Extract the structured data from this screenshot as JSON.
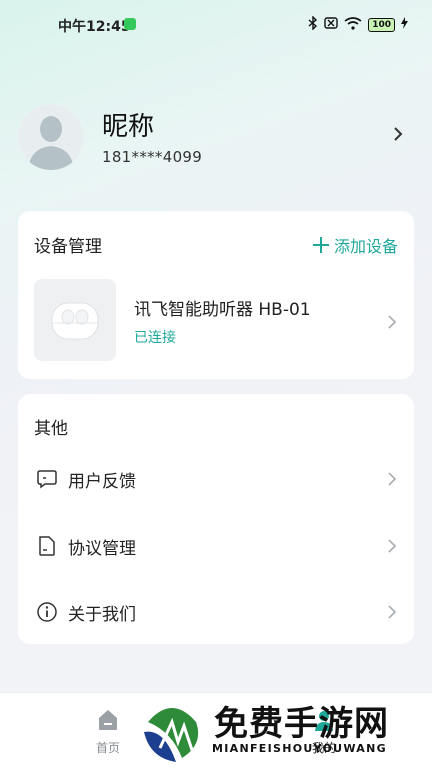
{
  "status_bar": {
    "time": "中午12:45",
    "battery": "100"
  },
  "profile": {
    "nickname": "昵称",
    "phone": "181****4099"
  },
  "device_section": {
    "title": "设备管理",
    "add_label": "添加设备",
    "device": {
      "name": "讯飞智能助听器 HB-01",
      "status": "已连接"
    }
  },
  "other_section": {
    "title": "其他",
    "items": [
      {
        "label": "用户反馈",
        "icon": "message-icon"
      },
      {
        "label": "协议管理",
        "icon": "document-icon"
      },
      {
        "label": "关于我们",
        "icon": "info-icon"
      }
    ]
  },
  "bottom_nav": {
    "home_label": "首页",
    "mine_label": "我的"
  },
  "watermark": {
    "text": "免费手游网",
    "sub": "MIANFEISHOUYOUWANG"
  },
  "colors": {
    "accent": "#1fa89a",
    "background": "#f2f3f6"
  }
}
